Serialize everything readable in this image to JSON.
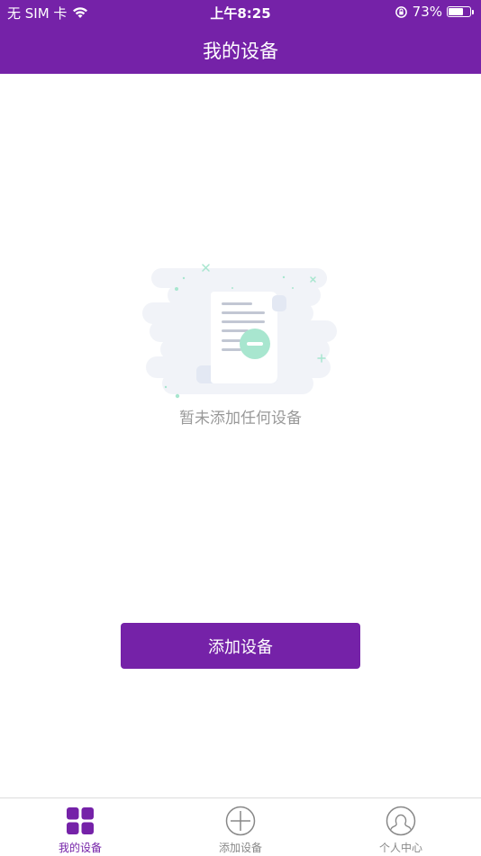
{
  "status_bar": {
    "carrier": "无 SIM 卡",
    "time": "上午8:25",
    "battery_percent": "73%",
    "battery_level": 0.73,
    "icons": [
      "wifi-icon",
      "rotation-lock-icon",
      "battery-icon"
    ]
  },
  "header": {
    "title": "我的设备"
  },
  "empty_state": {
    "message": "暂未添加任何设备",
    "icon": "empty-document-icon"
  },
  "actions": {
    "add_device_label": "添加设备"
  },
  "tabbar": {
    "items": [
      {
        "label": "我的设备",
        "icon": "grid-icon",
        "active": true
      },
      {
        "label": "添加设备",
        "icon": "add-circle-icon",
        "active": false
      },
      {
        "label": "个人中心",
        "icon": "user-icon",
        "active": false
      }
    ]
  },
  "colors": {
    "primary": "#7522a8",
    "tab_inactive": "#888888",
    "empty_text": "#999999",
    "illustration_accent": "#a8e6cf"
  }
}
